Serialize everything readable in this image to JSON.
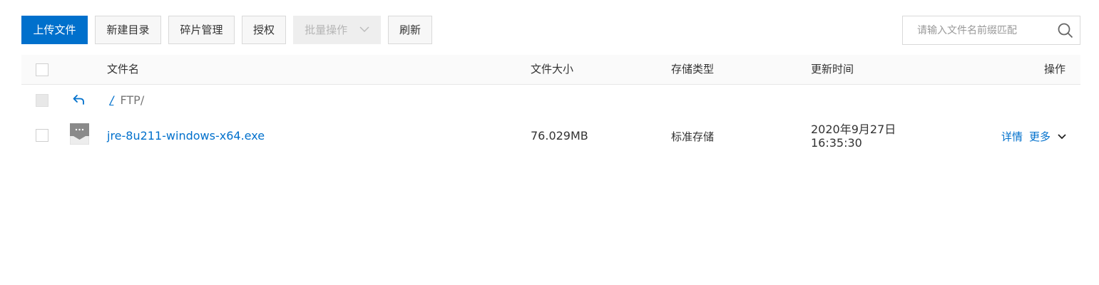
{
  "toolbar": {
    "upload_label": "上传文件",
    "new_dir_label": "新建目录",
    "fragments_label": "碎片管理",
    "authorize_label": "授权",
    "batch_label": "批量操作",
    "refresh_label": "刷新"
  },
  "search": {
    "placeholder": "请输入文件名前缀匹配",
    "icon": "search-icon"
  },
  "table": {
    "columns": {
      "name": "文件名",
      "size": "文件大小",
      "storage": "存储类型",
      "updated": "更新时间",
      "actions": "操作"
    },
    "path": {
      "root_sep": "/",
      "current": "FTP/"
    },
    "rows": [
      {
        "name": "jre-8u211-windows-x64.exe",
        "size": "76.029MB",
        "storage": "标准存储",
        "updated_date": "2020年9月27日",
        "updated_time": "16:35:30",
        "detail_label": "详情",
        "more_label": "更多"
      }
    ]
  },
  "colors": {
    "primary": "#0070cc",
    "header_bg": "#fafafa",
    "disabled_bg": "#eeeeee"
  }
}
